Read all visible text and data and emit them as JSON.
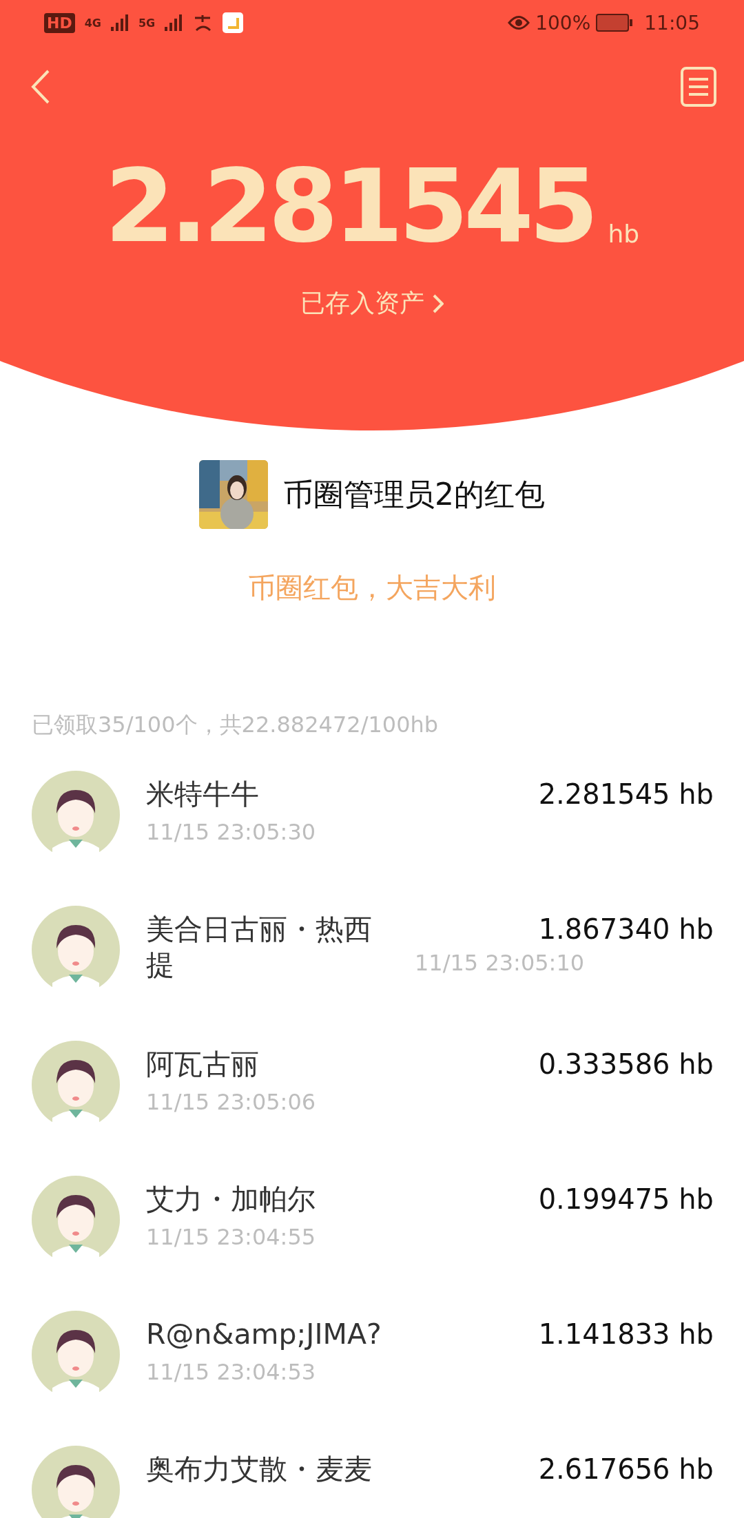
{
  "status_bar": {
    "left_labels": [
      "HD",
      "4G",
      "5G"
    ],
    "battery": "100%",
    "time": "11:05"
  },
  "header": {
    "amount": "2.281545",
    "unit": "hb",
    "link": "已存入资产"
  },
  "sender": {
    "title": "币圈管理员2的红包"
  },
  "blessing": "币圈红包，大吉大利",
  "summary": "已领取35/100个，共22.882472/100hb",
  "records": [
    {
      "kind": "short",
      "name": "米特牛牛",
      "amount": "2.281545 hb",
      "time": "11/15 23:05:30"
    },
    {
      "kind": "long",
      "name": "美合日古丽・热西提",
      "amount": "1.867340 hb",
      "time": "11/15 23:05:10"
    },
    {
      "kind": "short",
      "name": "阿瓦古丽",
      "amount": "0.333586 hb",
      "time": "11/15 23:05:06"
    },
    {
      "kind": "short",
      "name": "艾力・加帕尔",
      "amount": "0.199475 hb",
      "time": "11/15 23:04:55"
    },
    {
      "kind": "short",
      "name": "R@n&amp;JIMA?",
      "amount": "1.141833 hb",
      "time": "11/15 23:04:53"
    },
    {
      "kind": "cut",
      "name": "奥布力艾散・麦麦",
      "amount": "2.617656 hb"
    }
  ]
}
